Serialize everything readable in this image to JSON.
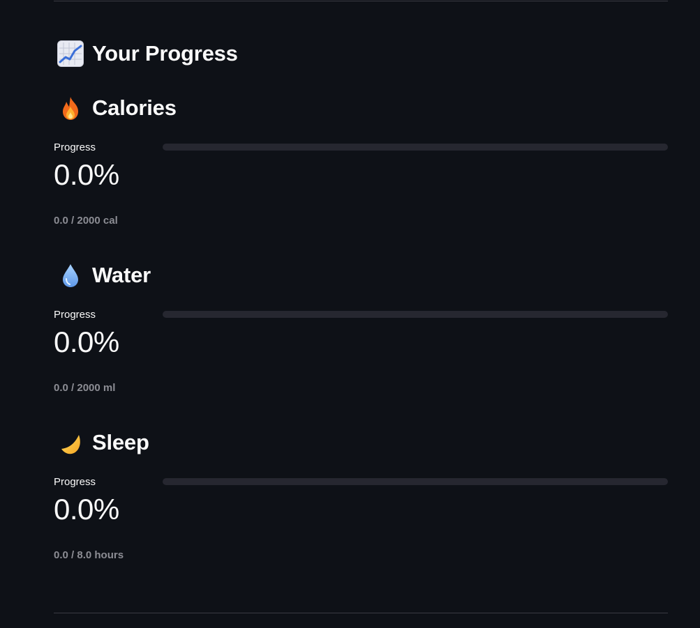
{
  "header": {
    "title": "Your Progress",
    "icon": "chart-increasing-icon"
  },
  "sections": [
    {
      "title": "Calories",
      "icon": "fire-icon",
      "progress_label": "Progress",
      "progress_fraction": 0.0,
      "value": "0.0%",
      "caption": "0.0 / 2000 cal"
    },
    {
      "title": "Water",
      "icon": "droplet-icon",
      "progress_label": "Progress",
      "progress_fraction": 0.0,
      "value": "0.0%",
      "caption": "0.0 / 2000 ml"
    },
    {
      "title": "Sleep",
      "icon": "crescent-moon-icon",
      "progress_label": "Progress",
      "progress_fraction": 0.0,
      "value": "0.0%",
      "caption": "0.0 / 8.0 hours"
    }
  ],
  "colors": {
    "background": "#0e1117",
    "text": "#fafafa",
    "caption": "#8c8d94",
    "track": "#262730",
    "divider": "#3a3b43"
  }
}
